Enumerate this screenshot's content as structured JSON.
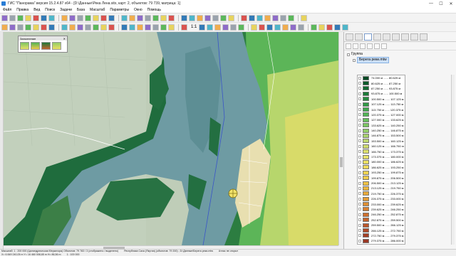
{
  "window": {
    "title": "ГИС \"Панорама\" версия 15.2.4.87 x64 - [D:\\Данные\\Река Лена.sitx, карт: 2, объектов: 79 739, матрица: 1]",
    "min_glyph": "—",
    "max_glyph": "☐",
    "close_glyph": "✕"
  },
  "menu": {
    "items": [
      "Файл",
      "Правка",
      "Вид",
      "Поиск",
      "Задачи",
      "База",
      "Масштаб",
      "Параметры",
      "Окно",
      "Помощь"
    ]
  },
  "toolbar": {
    "zoom_label": "1:1"
  },
  "legend_panel": {
    "title": "Заполнение",
    "close_glyph": "✕"
  },
  "layers_panel": {
    "group_label": "Группа",
    "layer_label": "Берега реки.mtw"
  },
  "height_scale": [
    {
      "range": "74.000 м ...... 80.625 м",
      "color": "#004a23"
    },
    {
      "range": "80.625 м ...... 87.250 м",
      "color": "#0a5a2a"
    },
    {
      "range": "87.250 м ...... 93.875 м",
      "color": "#126a31"
    },
    {
      "range": "93.875 м ...... 100.500 м",
      "color": "#1c7a38"
    },
    {
      "range": "100.500 м ...... 107.125 м",
      "color": "#268a3f"
    },
    {
      "range": "107.125 м ...... 113.750 м",
      "color": "#329a46"
    },
    {
      "range": "113.750 м ...... 120.375 м",
      "color": "#40a84d"
    },
    {
      "range": "120.375 м ...... 127.000 м",
      "color": "#52b455"
    },
    {
      "range": "127.000 м ...... 133.625 м",
      "color": "#66be5c"
    },
    {
      "range": "133.625 м ...... 140.250 м",
      "color": "#7cc663"
    },
    {
      "range": "140.250 м ...... 146.875 м",
      "color": "#92cc68"
    },
    {
      "range": "146.875 м ...... 153.500 м",
      "color": "#a8d26c"
    },
    {
      "range": "153.500 м ...... 160.125 м",
      "color": "#bcd66e"
    },
    {
      "range": "160.125 м ...... 166.750 m",
      "color": "#cedb6e"
    },
    {
      "range": "166.750 м ...... 173.375 м",
      "color": "#dcdf6c"
    },
    {
      "range": "173.375 м ...... 180.000 м",
      "color": "#e6e168"
    },
    {
      "range": "180.000 м ...... 186.625 м",
      "color": "#ece062"
    },
    {
      "range": "186.625 м ...... 193.250 м",
      "color": "#efdb5a"
    },
    {
      "range": "193.250 м ...... 199.875 м",
      "color": "#f0d452"
    },
    {
      "range": "199.875 м ...... 206.500 м",
      "color": "#f0cb4a"
    },
    {
      "range": "206.500 м ...... 213.125 м",
      "color": "#efc144"
    },
    {
      "range": "213.125 м ...... 219.750 м",
      "color": "#ecb63e"
    },
    {
      "range": "219.750 м ...... 226.375 м",
      "color": "#e8aa3a"
    },
    {
      "range": "226.375 м ...... 233.000 м",
      "color": "#e39c36"
    },
    {
      "range": "233.000 м ...... 239.625 м",
      "color": "#dd8e33"
    },
    {
      "range": "239.625 м ...... 246.250 м",
      "color": "#d67f30"
    },
    {
      "range": "246.250 м ...... 252.875 м",
      "color": "#ce702e"
    },
    {
      "range": "252.875 м ...... 259.500 м",
      "color": "#c5632c"
    },
    {
      "range": "259.500 м ...... 266.125 м",
      "color": "#bb562a"
    },
    {
      "range": "266.125 м ...... 272.750 м",
      "color": "#b04a28"
    },
    {
      "range": "272.750 м ...... 279.375 м",
      "color": "#a54026"
    },
    {
      "range": "279.375 м ...... 286.000 м",
      "color": "#993724"
    }
  ],
  "status": {
    "line1": [
      "Масштаб: 1 : 200 000 (Цилиндрическая Меркатора) Объектов: 79 783 / 3 (отображено / выделено)",
      "Республика Саха (Якутия) (объектов: 79 200) ; D:\\Данные\\Берега реки.mtw",
      "Атлас не открыт"
    ],
    "line2": [
      "X= 6 849 240,05 m   Y= 16 460 008,65 m   H= 86,56 m",
      "1 : 100 000"
    ]
  },
  "colors": {
    "river": "#6e9ba3",
    "land_satellite": "#b9c9b0",
    "forest_dark": "#1e6a3c",
    "settlement": "#e8dfb0"
  }
}
